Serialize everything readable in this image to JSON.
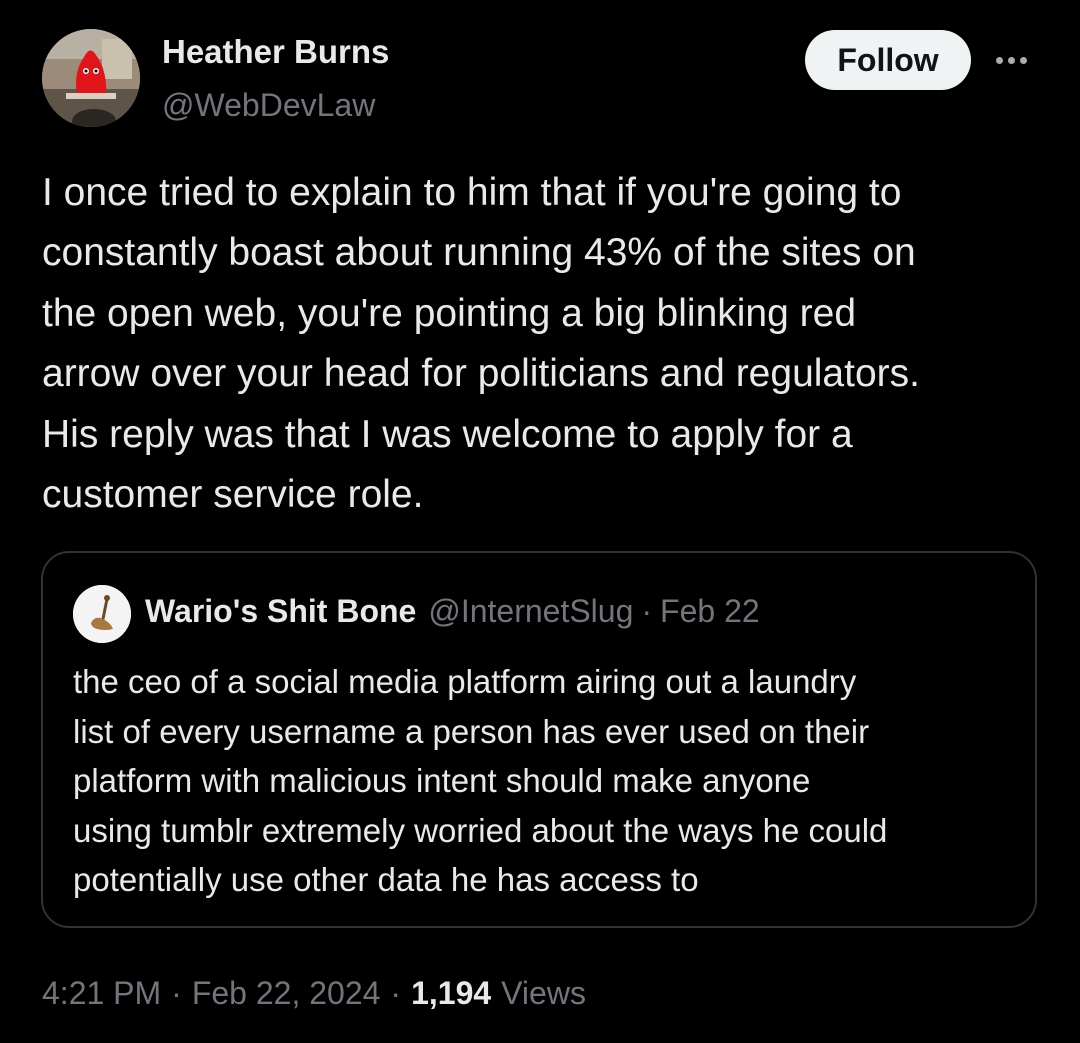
{
  "tweet": {
    "author": {
      "name": "Heather Burns",
      "handle": "@WebDevLaw",
      "avatar_icon": "profile-photo-red-blob"
    },
    "follow_label": "Follow",
    "more_icon": "more-horizontal-icon",
    "text": "I once tried to explain to him that if you're going to\nconstantly boast about running 43% of the sites on\nthe open web, you're pointing a big blinking red\narrow over your head for politicians and regulators.\nHis reply was that I was welcome to apply for a\ncustomer service role.",
    "quote": {
      "name": "Wario's Shit Bone",
      "handle": "@InternetSlug",
      "separator": "·",
      "date": "Feb 22",
      "avatar_icon": "bone-profile-icon",
      "text": "the ceo of a social media platform airing out a laundry\nlist of every username a person has ever used on their\nplatform with malicious intent should make anyone\nusing tumblr extremely worried about the ways he could\npotentially use other data he has access to"
    },
    "meta": {
      "time": "4:21 PM",
      "separator": "·",
      "date": "Feb 22, 2024",
      "views_count": "1,194",
      "views_label": "Views"
    }
  },
  "colors": {
    "background": "#000000",
    "text_primary": "#e7e9ea",
    "text_secondary": "#71767b",
    "border": "#2f3336",
    "follow_bg": "#eff3f4"
  }
}
